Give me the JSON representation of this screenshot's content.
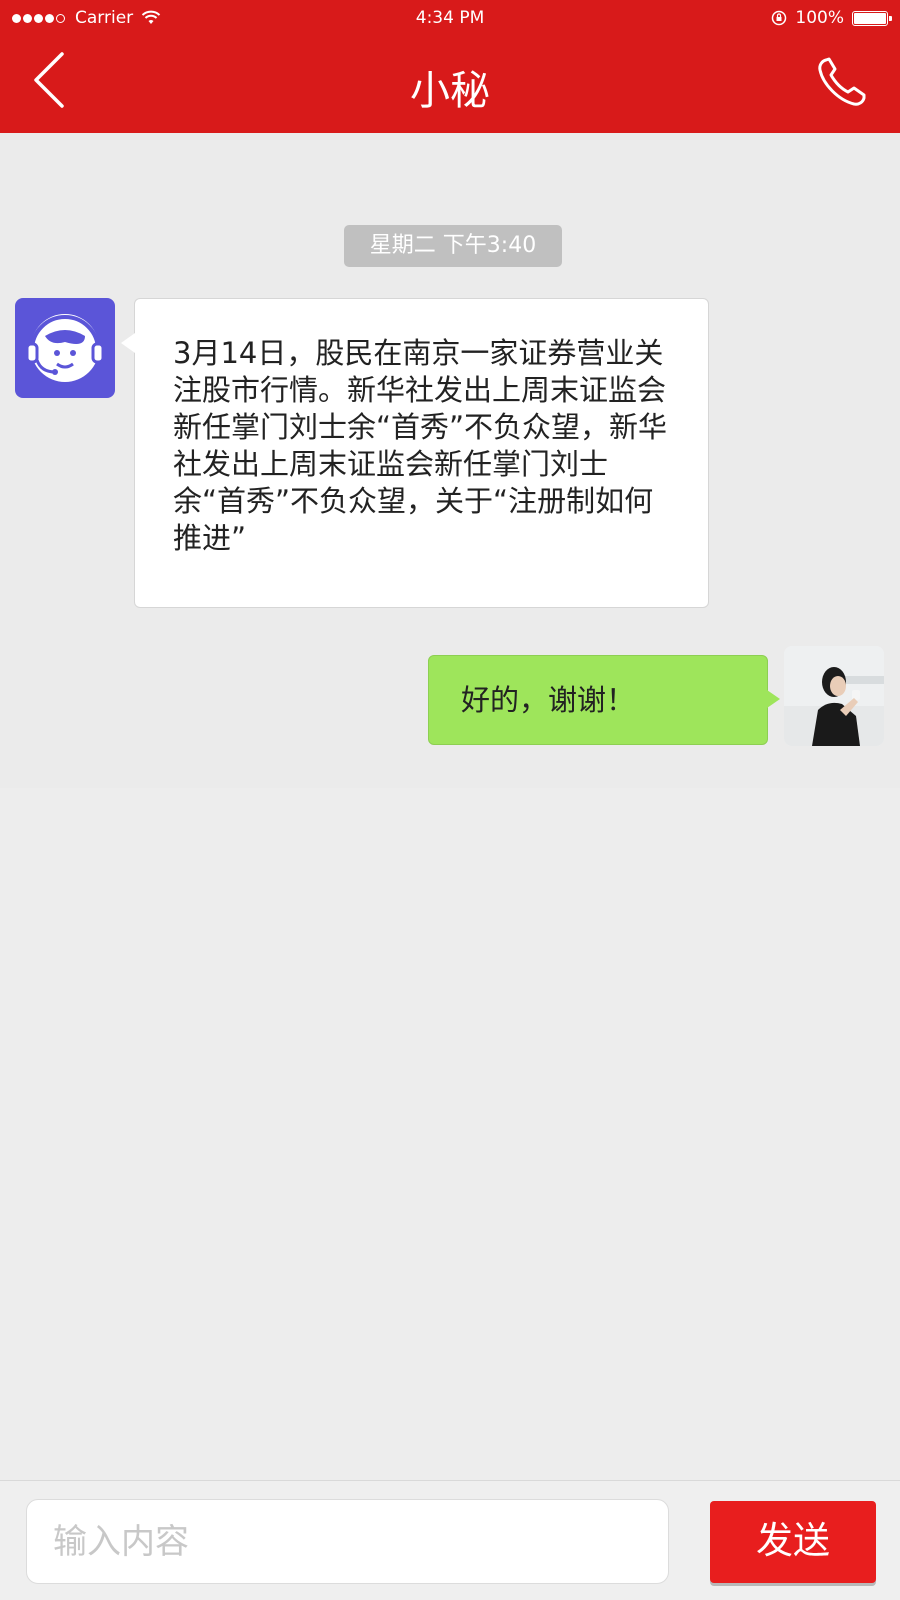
{
  "status_bar": {
    "carrier": "Carrier",
    "time": "4:34 PM",
    "battery": "100%"
  },
  "header": {
    "title": "小秘",
    "back_icon": "chevron-left-icon",
    "call_icon": "phone-icon"
  },
  "chat": {
    "timestamp": "星期二 下午3:40",
    "messages": [
      {
        "sender": "bot",
        "text": "3月14日，股民在南京一家证券营业关注股市行情。新华社发出上周末证监会新任掌门刘士余“首秀”不负众望，新华社发出上周末证监会新任掌门刘士余“首秀”不负众望，关于“注册制如何推进”"
      },
      {
        "sender": "user",
        "text": "好的，谢谢！"
      }
    ]
  },
  "input_bar": {
    "placeholder": "输入内容",
    "send_label": "发送"
  },
  "colors": {
    "brand_red": "#d81a1a",
    "send_red": "#e81e1e",
    "bubble_green": "#9ee55b",
    "bot_avatar": "#5b55d8"
  }
}
